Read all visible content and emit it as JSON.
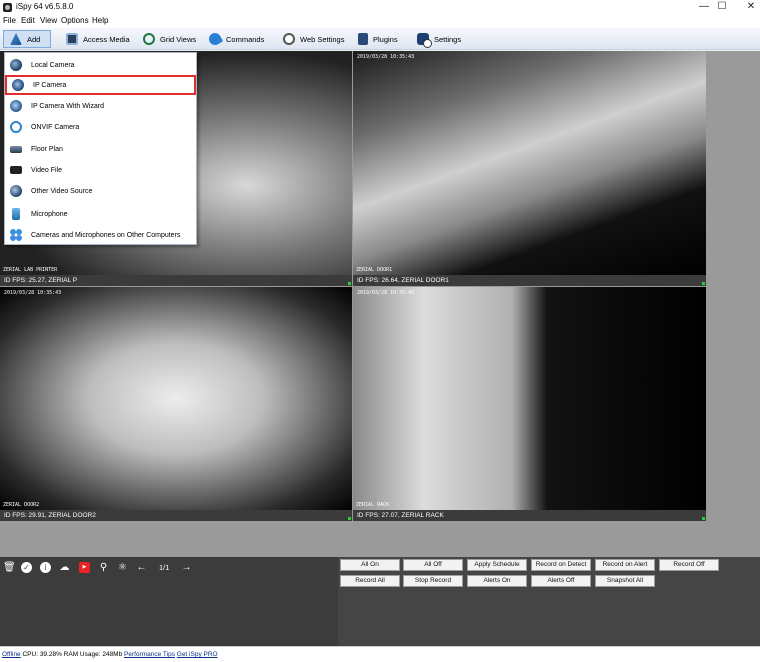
{
  "window": {
    "title": "iSpy 64 v6.5.8.0"
  },
  "menu": [
    "File",
    "Edit",
    "View",
    "Options",
    "Help"
  ],
  "toolbar": {
    "buttons": [
      {
        "label": "Add",
        "icon": "add-icon"
      },
      {
        "label": "Access Media",
        "icon": "access-media-icon"
      },
      {
        "label": "Grid Views",
        "icon": "grid-views-icon"
      },
      {
        "label": "Commands",
        "icon": "commands-icon"
      },
      {
        "label": "Web Settings",
        "icon": "web-settings-icon"
      },
      {
        "label": "Plugins",
        "icon": "plugins-icon"
      },
      {
        "label": "Settings",
        "icon": "settings-icon"
      }
    ]
  },
  "add_menu": {
    "items": [
      {
        "label": "Local Camera",
        "icon": "local-camera-icon"
      },
      {
        "label": "IP Camera",
        "icon": "ip-camera-icon",
        "highlighted": true
      },
      {
        "label": "IP Camera With Wizard",
        "icon": "ip-camera-wizard-icon"
      },
      {
        "label": "ONVIF Camera",
        "icon": "onvif-camera-icon"
      },
      {
        "label": "Floor Plan",
        "icon": "floor-plan-icon"
      },
      {
        "label": "Video File",
        "icon": "video-file-icon"
      },
      {
        "label": "Other Video Source",
        "icon": "other-video-source-icon"
      },
      {
        "label": "Microphone",
        "icon": "microphone-icon"
      },
      {
        "label": "Cameras and Microphones on Other Computers",
        "icon": "network-devices-icon"
      }
    ],
    "highlight_color": "#e32c2c"
  },
  "cameras": [
    {
      "overlay_label": "ZERIAL LAB PRINTER",
      "status": "ID  FPS: 25.27, ZERIAL P",
      "stamp": ""
    },
    {
      "overlay_label": "ZERIAL DOOR1",
      "status": "ID  FPS: 26.64, ZERIAL DOOR1",
      "stamp": "2019/03/28 10:35:43"
    },
    {
      "overlay_label": "ZERIAL DOOR2",
      "status": "ID  FPS: 29.91, ZERIAL DOOR2",
      "stamp": "2019/03/28 10:35:43"
    },
    {
      "overlay_label": "ZERIAL RACK",
      "status": "ID  FPS: 27.07, ZERIAL RACK",
      "stamp": "2019/03/28 10:35:43"
    }
  ],
  "bottom": {
    "icons": [
      "trash-icon",
      "check-icon",
      "info-icon",
      "cloud-upload-icon",
      "youtube-icon",
      "search-icon",
      "hierarchy-icon",
      "arrow-left-icon",
      "arrow-right-icon"
    ],
    "page_indicator": "1/1",
    "buttons_row1": [
      "All On",
      "All Off",
      "Apply Schedule",
      "Record on Detect",
      "Record on Alert",
      "Record Off"
    ],
    "buttons_row2": [
      "Record All",
      "Stop Record",
      "Alerts On",
      "Alerts Off",
      "Snapshot All"
    ]
  },
  "status": {
    "state": "Offline",
    "cpu_ram": "CPU: 39.28% RAM Usage: 248Mb",
    "performance_link": "Performance Tips",
    "pro_link": "Get iSpy PRO"
  }
}
